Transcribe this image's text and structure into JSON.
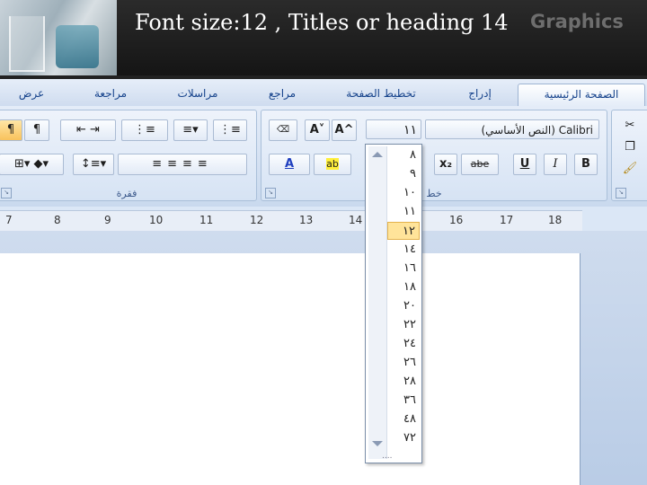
{
  "slide": {
    "title": "Font size:12 , Titles or heading 14",
    "watermark": "Graphics"
  },
  "tabs": [
    "الصفحة الرئيسية",
    "إدراج",
    "تخطيط الصفحة",
    "مراجع",
    "مراسلات",
    "مراجعة",
    "عرض"
  ],
  "ribbon": {
    "font_group_label": "خط",
    "paragraph_group_label": "فقرة",
    "font_name": "Calibri (النص الأساسي)",
    "font_size": "١١",
    "buttons": {
      "bold": "B",
      "italic": "I",
      "underline": "U",
      "strike": "abe",
      "subscript": "x₂",
      "grow": "A^",
      "shrink": "A˅",
      "font_color": "A",
      "highlight": "ab",
      "pilcrow_rtl": "¶",
      "pilcrow_ltr": "¶"
    }
  },
  "ruler": {
    "numbers": [
      "7",
      "8",
      "9",
      "10",
      "11",
      "12",
      "13",
      "14",
      "16",
      "17",
      "18"
    ]
  },
  "font_size_dropdown": {
    "options": [
      "٨",
      "٩",
      "١٠",
      "١١",
      "١٢",
      "١٤",
      "١٦",
      "١٨",
      "٢٠",
      "٢٢",
      "٢٤",
      "٢٦",
      "٢٨",
      "٣٦",
      "٤٨",
      "٧٢"
    ],
    "selected": "١٢",
    "grip": "...."
  }
}
